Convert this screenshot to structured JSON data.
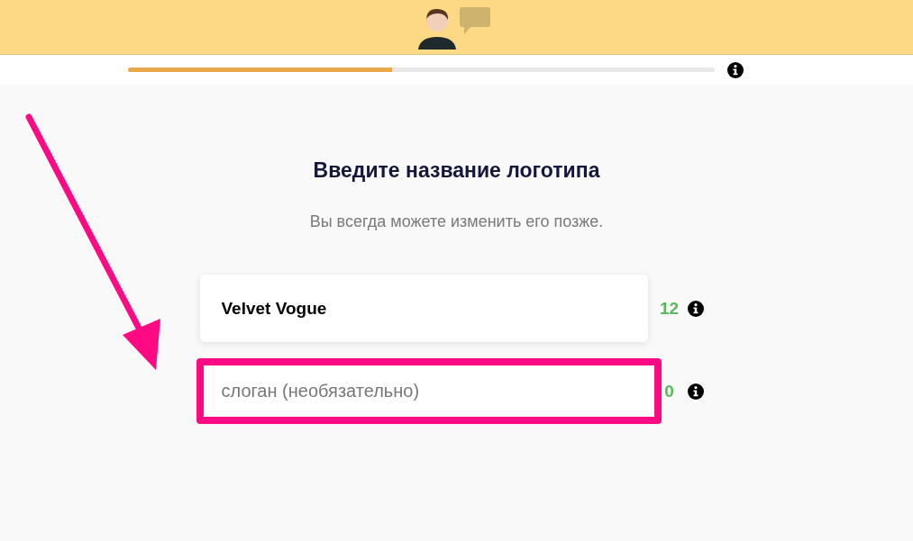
{
  "progress": {
    "level": 0.45
  },
  "heading": "Введите название логотипа",
  "subtitle": "Вы всегда можете изменить его позже.",
  "fields": [
    {
      "value": "Velvet Vogue",
      "count": "12",
      "highlighted": false
    },
    {
      "placeholder": "слоган (необязательно)",
      "count": "0",
      "highlighted": true
    }
  ]
}
